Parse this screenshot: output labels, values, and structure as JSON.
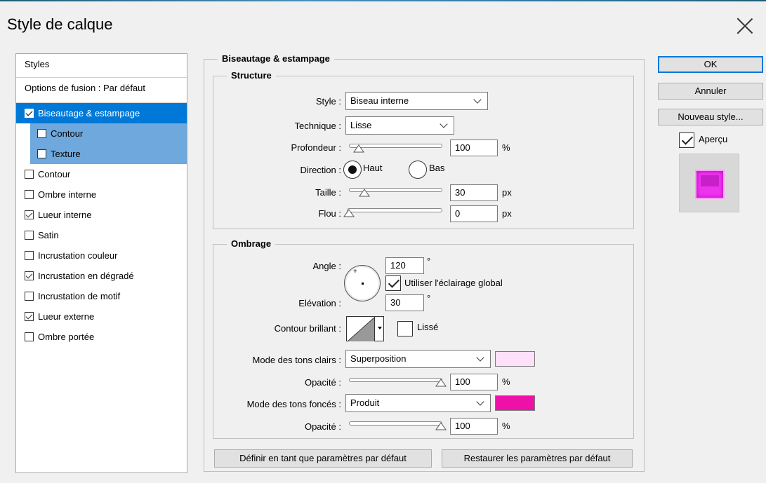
{
  "window": {
    "title": "Style de calque"
  },
  "styles_panel": {
    "header": "Styles",
    "fusion_options": "Options de fusion : Par défaut",
    "items": [
      {
        "label": "Biseautage & estampage",
        "checked": true,
        "selected": true
      },
      {
        "label": "Contour",
        "checked": false,
        "sub": true
      },
      {
        "label": "Texture",
        "checked": false,
        "sub": true
      },
      {
        "label": "Contour",
        "checked": false
      },
      {
        "label": "Ombre interne",
        "checked": false
      },
      {
        "label": "Lueur interne",
        "checked": true
      },
      {
        "label": "Satin",
        "checked": false
      },
      {
        "label": "Incrustation couleur",
        "checked": false
      },
      {
        "label": "Incrustation en dégradé",
        "checked": true
      },
      {
        "label": "Incrustation de motif",
        "checked": false
      },
      {
        "label": "Lueur externe",
        "checked": true
      },
      {
        "label": "Ombre portée",
        "checked": false
      }
    ]
  },
  "bevel": {
    "group_title": "Biseautage & estampage",
    "structure_title": "Structure",
    "style_label": "Style :",
    "style_value": "Biseau interne",
    "technique_label": "Technique :",
    "technique_value": "Lisse",
    "depth_label": "Profondeur :",
    "depth_value": "100",
    "depth_unit": "%",
    "direction_label": "Direction :",
    "direction_up": "Haut",
    "direction_down": "Bas",
    "size_label": "Taille :",
    "size_value": "30",
    "size_unit": "px",
    "soften_label": "Flou :",
    "soften_value": "0",
    "soften_unit": "px"
  },
  "shading": {
    "title": "Ombrage",
    "angle_label": "Angle :",
    "angle_value": "120",
    "degree_symbol": "°",
    "global_light_label": "Utiliser l'éclairage global",
    "global_light_checked": true,
    "altitude_label": "Elévation :",
    "altitude_value": "30",
    "gloss_label": "Contour brillant :",
    "antialias_label": "Lissé",
    "highlight_mode_label": "Mode des tons clairs :",
    "highlight_mode_value": "Superposition",
    "highlight_color": "#ffe0fb",
    "highlight_opacity_label": "Opacité :",
    "highlight_opacity_value": "100",
    "shadow_mode_label": "Mode des tons foncés :",
    "shadow_mode_value": "Produit",
    "shadow_color": "#ee11a8",
    "shadow_opacity_label": "Opacité :",
    "shadow_opacity_value": "100",
    "percent": "%"
  },
  "footer": {
    "set_default": "Définir en tant que paramètres par défaut",
    "reset_default": "Restaurer les paramètres par défaut"
  },
  "right": {
    "ok": "OK",
    "cancel": "Annuler",
    "new_style": "Nouveau style...",
    "preview_label": "Aperçu",
    "preview_checked": true
  }
}
